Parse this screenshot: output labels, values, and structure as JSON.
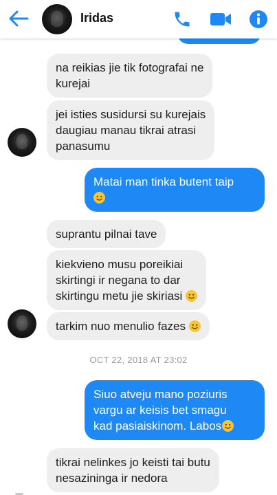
{
  "header": {
    "contact_name": "Iridas",
    "icons": [
      "back-arrow-icon",
      "phone-icon",
      "video-camera-icon",
      "info-icon"
    ],
    "accent_color": "#1e88f5"
  },
  "messages": [
    {
      "dir": "in",
      "text": "na reikias jie tik fotografai ne\nkurejai"
    },
    {
      "dir": "in",
      "text": "jei isties susidursi su kurejais\ndaugiau manau tikrai atrasi\npanasumu"
    },
    {
      "dir": "out",
      "text": "Matai man tinka butent taip",
      "emoji": "😊"
    },
    {
      "dir": "in",
      "text": "suprantu pilnai tave"
    },
    {
      "dir": "in",
      "text": "kiekvieno musu poreikiai\nskirtingi ir negana to dar\nskirtingu metu jie skiriasi",
      "emoji": "🙂"
    },
    {
      "dir": "in",
      "text": "tarkim nuo menulio fazes",
      "emoji": "🙂"
    },
    {
      "dir": "out",
      "text": "Siuo atveju mano poziuris\nvargu ar keisis bet smagu\nkad pasiaiskinom. Labos",
      "emoji": "😊"
    },
    {
      "dir": "in",
      "text": "tikrai nelinkes jo keisti tai butu\nnesazininga ir nedora"
    }
  ],
  "timestamp": "OCT 22, 2018 AT 23:02",
  "colors": {
    "incoming_bubble": "#eeeeef",
    "outgoing_bubble": "#1e88f5"
  }
}
